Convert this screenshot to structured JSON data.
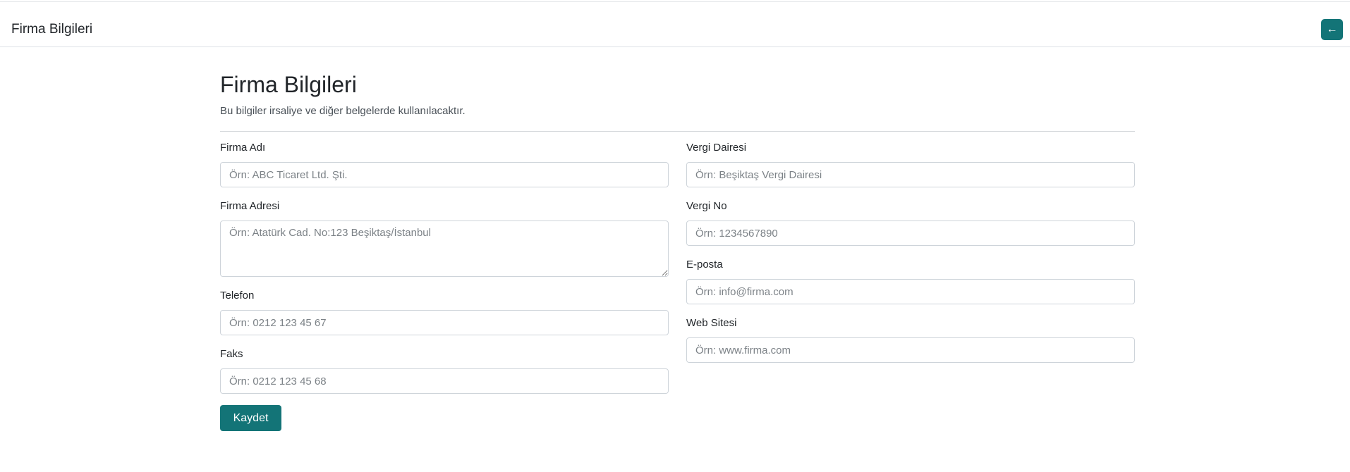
{
  "header": {
    "title": "Firma Bilgileri",
    "back_icon": "←"
  },
  "page": {
    "title": "Firma Bilgileri",
    "subtitle": "Bu bilgiler irsaliye ve diğer belgelerde kullanılacaktır."
  },
  "form": {
    "company_name": {
      "label": "Firma Adı",
      "placeholder": "Örn: ABC Ticaret Ltd. Şti.",
      "value": ""
    },
    "company_address": {
      "label": "Firma Adresi",
      "placeholder": "Örn: Atatürk Cad. No:123 Beşiktaş/İstanbul",
      "value": ""
    },
    "phone": {
      "label": "Telefon",
      "placeholder": "Örn: 0212 123 45 67",
      "value": ""
    },
    "fax": {
      "label": "Faks",
      "placeholder": "Örn: 0212 123 45 68",
      "value": ""
    },
    "tax_office": {
      "label": "Vergi Dairesi",
      "placeholder": "Örn: Beşiktaş Vergi Dairesi",
      "value": ""
    },
    "tax_number": {
      "label": "Vergi No",
      "placeholder": "Örn: 1234567890",
      "value": ""
    },
    "email": {
      "label": "E-posta",
      "placeholder": "Örn: info@firma.com",
      "value": ""
    },
    "website": {
      "label": "Web Sitesi",
      "placeholder": "Örn: www.firma.com",
      "value": ""
    },
    "save_label": "Kaydet"
  },
  "colors": {
    "primary": "#137477",
    "border": "#ced4da",
    "text": "#212529"
  }
}
